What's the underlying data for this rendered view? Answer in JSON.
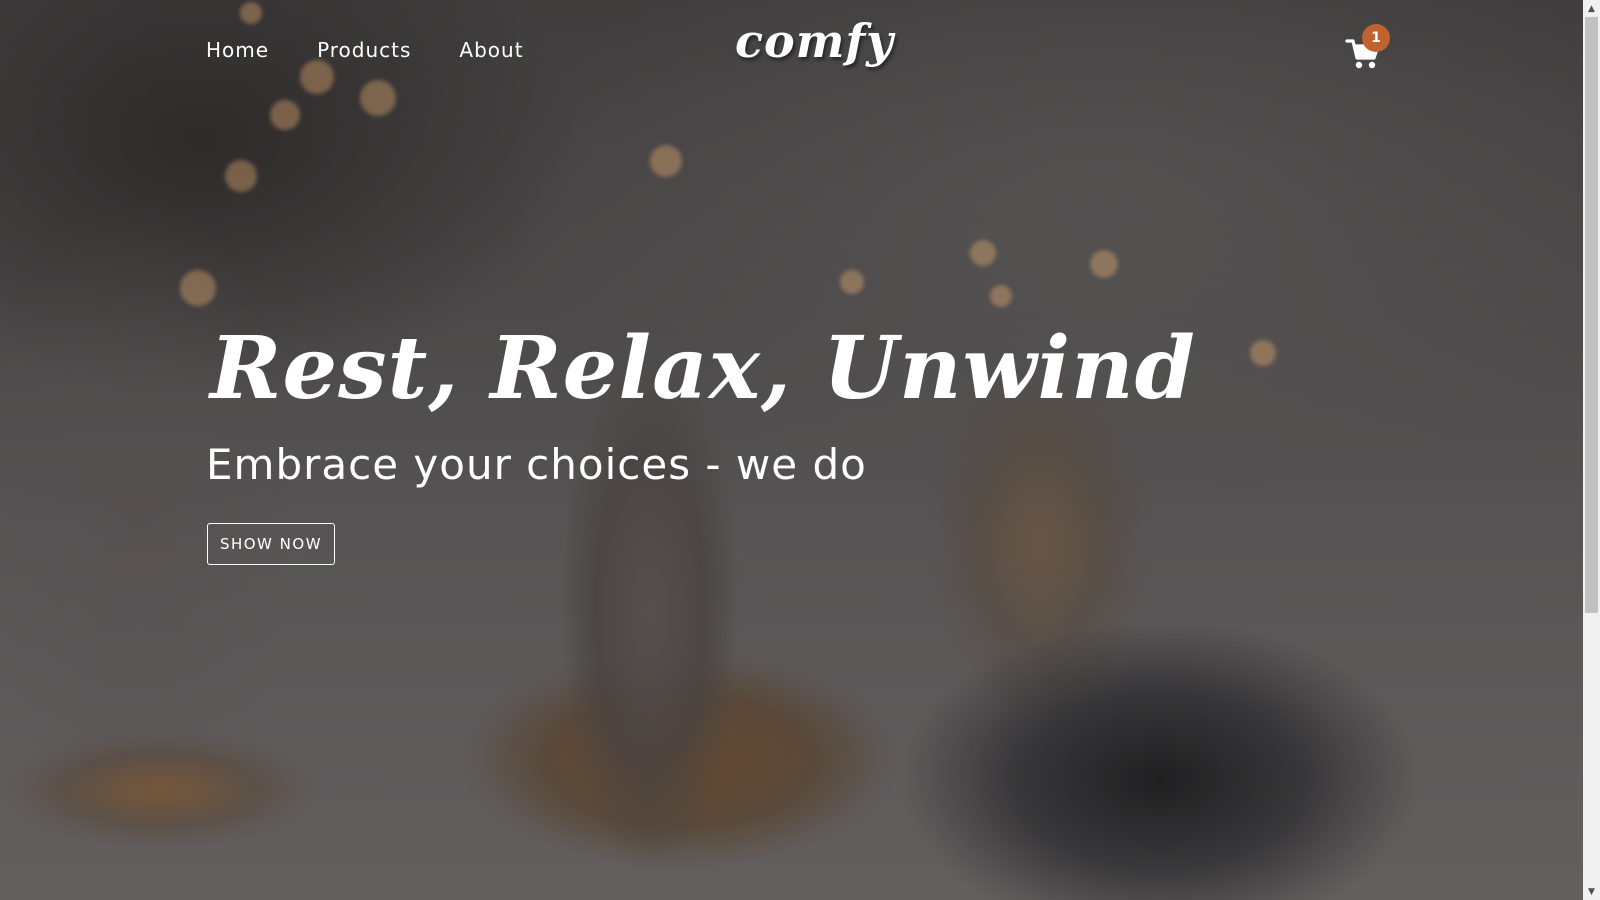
{
  "navbar": {
    "links": [
      "Home",
      "Products",
      "About"
    ],
    "logo": "comfy",
    "cart": {
      "icon": "shopping-cart-icon",
      "count": "1"
    }
  },
  "hero": {
    "title": "Rest, Relax, Unwind",
    "subtitle": "Embrace your choices - we do",
    "button_label": "SHOW NOW"
  },
  "colors": {
    "badge": "#c0632f",
    "text": "#ffffff"
  },
  "scrollbar": {
    "up_icon": "chevron-up-icon",
    "down_icon": "chevron-down-icon"
  }
}
